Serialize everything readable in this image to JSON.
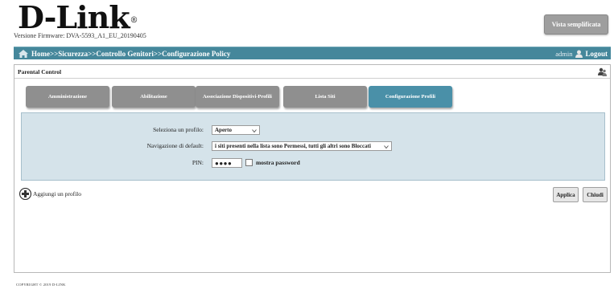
{
  "brand": {
    "logo_text": "D-Link",
    "registered": "®"
  },
  "firmware": "Versione Firmware: DVA-5593_A1_EU_20190405",
  "header": {
    "simple_view_label": "Vista semplificata"
  },
  "navbar": {
    "breadcrumb": "Home>>Sicurezza>>Controllo Genitori>>Configurazione Policy",
    "user": "admin",
    "logout": "Logout"
  },
  "panel": {
    "title": "Parental Control",
    "tabs": [
      {
        "label": "Amministrazione",
        "active": false
      },
      {
        "label": "Abilitazione",
        "active": false
      },
      {
        "label": "Associazione Dispositivi-Profili",
        "active": false
      },
      {
        "label": "Lista Siti",
        "active": false
      },
      {
        "label": "Configurazione Profili",
        "active": true
      }
    ]
  },
  "form": {
    "profile_label": "Seleziona un profilo:",
    "profile_value": "Aperto",
    "default_nav_label": "Navigazione di default:",
    "default_nav_value": "i siti presenti nella lista sono Permessi, tutti gli altri sono Bloccati",
    "pin_label": "PIN:",
    "pin_value": "●●●●",
    "show_password_label": "mostra password",
    "show_password_checked": false
  },
  "actions": {
    "add_profile": "Aggiungi un profilo",
    "apply": "Applica",
    "close": "Chiudi"
  },
  "footer": {
    "copyright": "COPYRIGHT © 2019 D-LINK"
  },
  "colors": {
    "nav_bg": "#45879b",
    "tab_inactive": "#8f8f8f",
    "tab_active": "#4a90a8",
    "form_bg": "#d5e3ea"
  }
}
